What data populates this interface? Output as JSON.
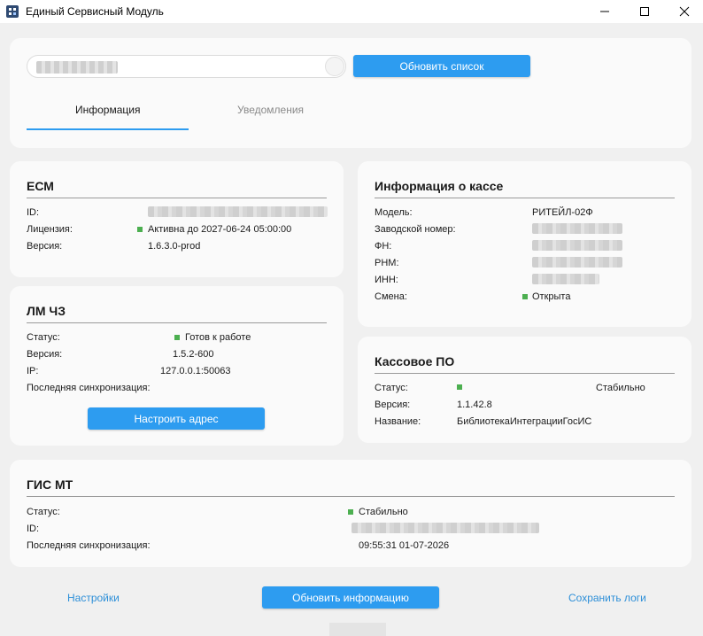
{
  "window": {
    "title": "Единый Сервисный Модуль",
    "minimize_glyph": "—",
    "maximize_glyph": "☐",
    "close_glyph": "✕"
  },
  "top": {
    "search_value": "",
    "refresh_list_label": "Обновить список",
    "tabs": [
      {
        "label": "Информация",
        "active": true
      },
      {
        "label": "Уведомления",
        "active": false
      }
    ]
  },
  "ecm": {
    "title": "ЕСМ",
    "id_label": "ID:",
    "license_label": "Лицензия:",
    "license_value": "Активна до 2027-06-24 05:00:00",
    "version_label": "Версия:",
    "version_value": "1.6.3.0-prod"
  },
  "lm": {
    "title": "ЛМ ЧЗ",
    "status_label": "Статус:",
    "status_value": "Готов к работе",
    "version_label": "Версия:",
    "version_value": "1.5.2-600",
    "ip_label": "IP:",
    "ip_value": "127.0.0.1:50063",
    "sync_label": "Последняя синхронизация:",
    "set_address_label": "Настроить адрес"
  },
  "kassa": {
    "title": "Информация о кассе",
    "model_label": "Модель:",
    "model_value": "РИТЕЙЛ-02Ф",
    "serial_label": "Заводской номер:",
    "fn_label": "ФН:",
    "rnm_label": "РНМ:",
    "inn_label": "ИНН:",
    "shift_label": "Смена:",
    "shift_value": "Открыта"
  },
  "po": {
    "title": "Кассовое ПО",
    "status_label": "Статус:",
    "status_value": "Стабильно",
    "version_label": "Версия:",
    "version_value": "1.1.42.8",
    "name_label": "Название:",
    "name_value": "БиблиотекаИнтеграцииГосИС"
  },
  "gis": {
    "title": "ГИС МТ",
    "status_label": "Статус:",
    "status_value": "Стабильно",
    "id_label": "ID:",
    "sync_label": "Последняя синхронизация:",
    "sync_value": "09:55:31 01-07-2026"
  },
  "footer": {
    "settings_label": "Настройки",
    "refresh_info_label": "Обновить информацию",
    "save_logs_label": "Сохранить логи"
  },
  "colors": {
    "accent": "#2d9cf0",
    "status_ok": "#4caf50",
    "link": "#2d8fd8"
  },
  "icons": {
    "app": "app-icon",
    "minimize": "minimize-icon",
    "maximize": "maximize-icon",
    "close": "close-icon"
  }
}
